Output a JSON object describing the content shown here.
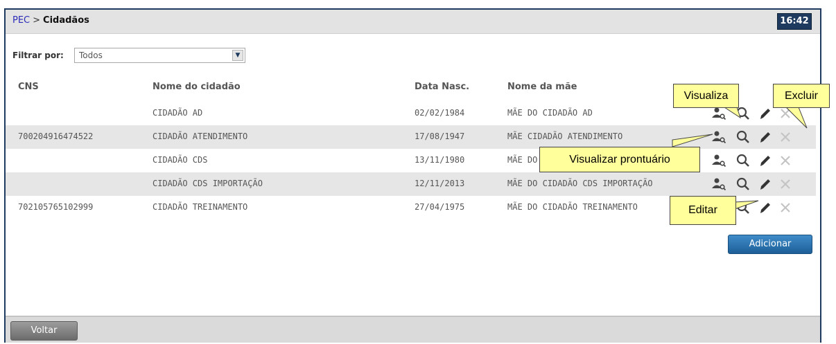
{
  "header": {
    "breadcrumb_root": "PEC",
    "breadcrumb_sep": ">",
    "breadcrumb_current": "Cidadãos",
    "clock": "16:42"
  },
  "filter": {
    "label": "Filtrar por:",
    "selected": "Todos"
  },
  "table": {
    "columns": [
      "CNS",
      "Nome do cidadão",
      "Data Nasc.",
      "Nome da mãe"
    ],
    "rows": [
      {
        "cns": "",
        "nome": "CIDADÃO AD",
        "data": "02/02/1984",
        "mae": "MÃE DO CIDADÃO AD"
      },
      {
        "cns": "700204916474522",
        "nome": "CIDADÃO ATENDIMENTO",
        "data": "17/08/1947",
        "mae": "MÃE CIDADÃO ATENDIMENTO"
      },
      {
        "cns": "",
        "nome": "CIDADÃO CDS",
        "data": "13/11/1980",
        "mae": "MÃE DO CIDADÃO CDS"
      },
      {
        "cns": "",
        "nome": "CIDADÃO CDS IMPORTAÇÃO",
        "data": "12/11/2013",
        "mae": "MÃE DO CIDADÃO CDS IMPORTAÇÃO"
      },
      {
        "cns": "702105765102999",
        "nome": "CIDADÃO TREINAMENTO",
        "data": "27/04/1975",
        "mae": "MÃE DO CIDADÃO TREINAMENTO"
      }
    ]
  },
  "buttons": {
    "add": "Adicionar",
    "back": "Voltar"
  },
  "callouts": {
    "visualiza": "Visualiza",
    "excluir": "Excluir",
    "prontuario": "Visualizar prontuário",
    "editar": "Editar"
  },
  "icons": {
    "prontuario": "person-search-icon",
    "view": "magnifier-icon",
    "edit": "pencil-icon",
    "delete": "x-icon"
  },
  "colors": {
    "frame": "#1f3a5f",
    "callout": "#ffff9b",
    "add_button": "#2a73b3",
    "row_alt": "#e6e6e6"
  }
}
